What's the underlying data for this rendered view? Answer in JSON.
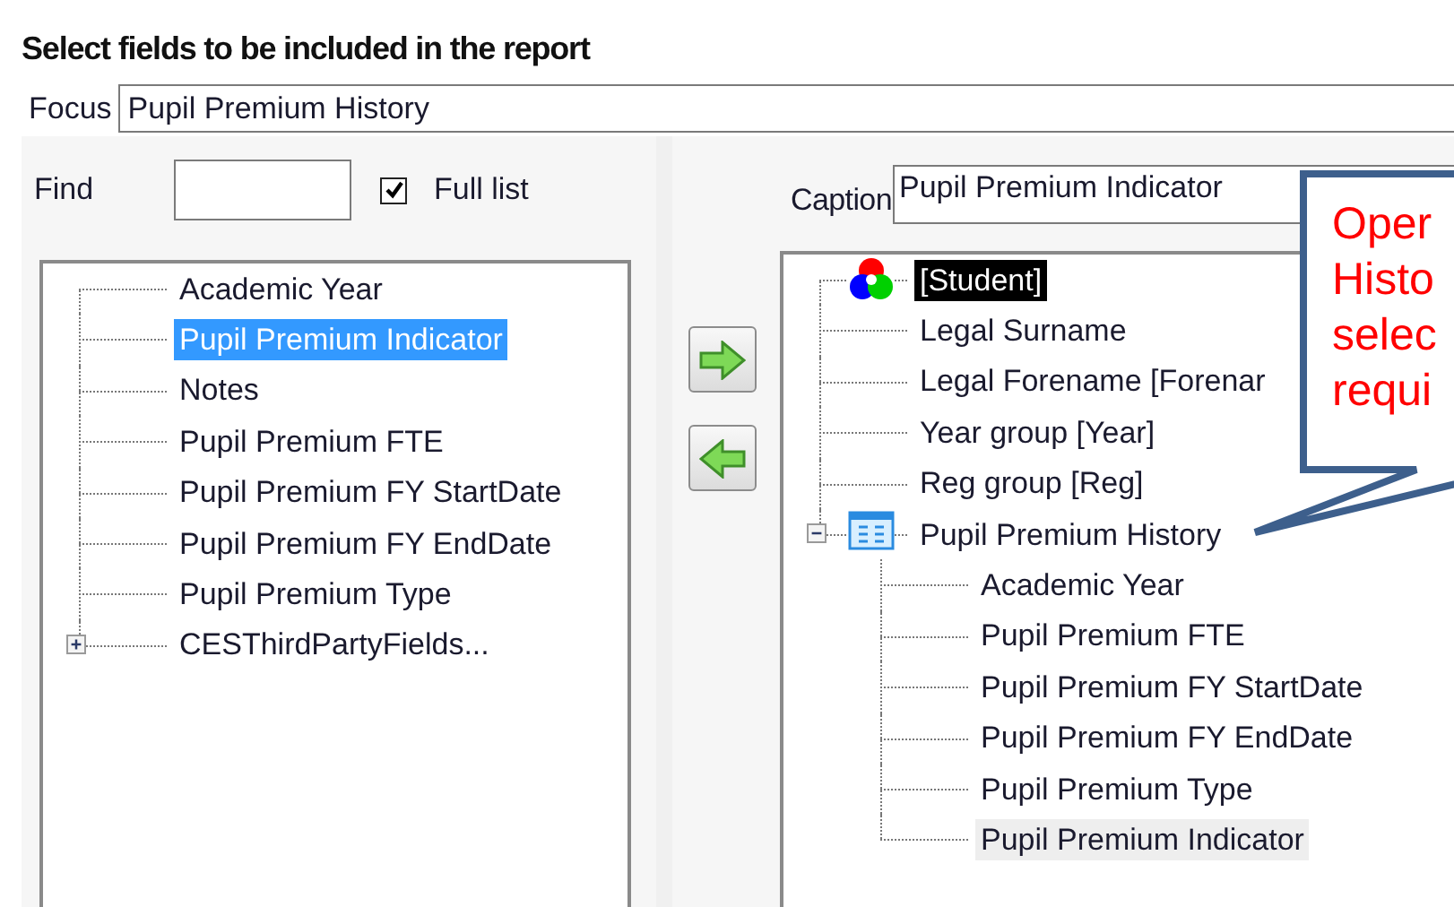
{
  "title": "Select fields to be included in the report",
  "focus": {
    "label": "Focus",
    "value": "Pupil Premium History"
  },
  "find": {
    "label": "Find"
  },
  "full_list": {
    "label": "Full list",
    "checked": true
  },
  "available_fields": [
    {
      "label": "Academic Year",
      "kind": "field",
      "selected": false
    },
    {
      "label": "Pupil Premium Indicator",
      "kind": "field",
      "selected": true
    },
    {
      "label": "Notes",
      "kind": "field",
      "selected": false
    },
    {
      "label": "Pupil Premium FTE",
      "kind": "field",
      "selected": false
    },
    {
      "label": "Pupil Premium FY StartDate",
      "kind": "field",
      "selected": false
    },
    {
      "label": "Pupil Premium FY EndDate",
      "kind": "field",
      "selected": false
    },
    {
      "label": "Pupil Premium Type",
      "kind": "field",
      "selected": false
    },
    {
      "label": "CESThirdPartyFields...",
      "kind": "group",
      "expanded": false,
      "selected": false
    }
  ],
  "caption": {
    "label": "Caption",
    "value": "Pupil Premium Indicator"
  },
  "report_fields": [
    {
      "label": "[Student]",
      "kind": "root"
    },
    {
      "label": "Legal Surname",
      "kind": "field",
      "selected": false
    },
    {
      "label": "Legal Forename [Forenar",
      "kind": "field",
      "selected": false
    },
    {
      "label": "Year group [Year]",
      "kind": "field",
      "selected": false
    },
    {
      "label": "Reg group [Reg]",
      "kind": "field",
      "selected": false
    },
    {
      "label": "Pupil Premium History",
      "kind": "group",
      "expanded": true,
      "selected": false,
      "children": [
        {
          "label": "Academic Year",
          "kind": "field",
          "selected": false
        },
        {
          "label": "Pupil Premium FTE",
          "kind": "field",
          "selected": false
        },
        {
          "label": "Pupil Premium FY StartDate",
          "kind": "field",
          "selected": false
        },
        {
          "label": "Pupil Premium FY EndDate",
          "kind": "field",
          "selected": false
        },
        {
          "label": "Pupil Premium Type",
          "kind": "field",
          "selected": false
        },
        {
          "label": "Pupil Premium Indicator",
          "kind": "field",
          "selected": true
        }
      ]
    }
  ],
  "callout": {
    "lines": [
      "Oper",
      "Histo",
      "selec",
      "requi"
    ]
  }
}
